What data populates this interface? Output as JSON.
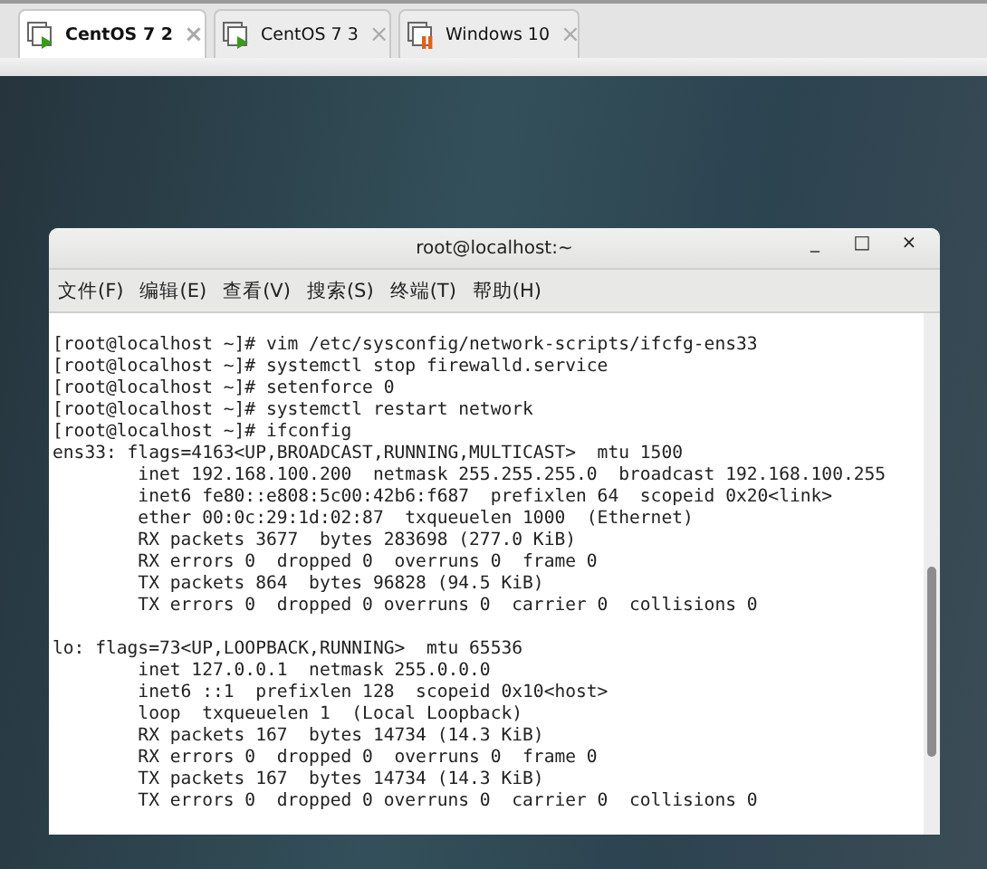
{
  "tabs": [
    {
      "label": "CentOS 7 2",
      "selected": true,
      "kind": "running",
      "close": "×"
    },
    {
      "label": "CentOS 7 3",
      "selected": false,
      "kind": "running",
      "close": "×"
    },
    {
      "label": "Windows 10",
      "selected": false,
      "kind": "paused",
      "close": "×"
    }
  ],
  "terminal": {
    "title": "root@localhost:~",
    "window_controls": [
      "_",
      "□",
      "×"
    ],
    "menu": [
      "文件(F)",
      "编辑(E)",
      "查看(V)",
      "搜索(S)",
      "终端(T)",
      "帮助(H)"
    ],
    "blocks": [
      [
        "[root@localhost ~]# vim /etc/sysconfig/network-scripts/ifcfg-ens33",
        "[root@localhost ~]# systemctl stop firewalld.service",
        "[root@localhost ~]# setenforce 0",
        "[root@localhost ~]# systemctl restart network",
        "[root@localhost ~]# ifconfig",
        "ens33: flags=4163<UP,BROADCAST,RUNNING,MULTICAST>  mtu 1500",
        "        inet 192.168.100.200  netmask 255.255.255.0  broadcast 192.168.100.255",
        "        inet6 fe80::e808:5c00:42b6:f687  prefixlen 64  scopeid 0x20<link>",
        "        ether 00:0c:29:1d:02:87  txqueuelen 1000  (Ethernet)",
        "        RX packets 3677  bytes 283698 (277.0 KiB)",
        "        RX errors 0  dropped 0  overruns 0  frame 0",
        "        TX packets 864  bytes 96828 (94.5 KiB)",
        "        TX errors 0  dropped 0 overruns 0  carrier 0  collisions 0"
      ],
      [
        "lo: flags=73<UP,LOOPBACK,RUNNING>  mtu 65536",
        "        inet 127.0.0.1  netmask 255.0.0.0",
        "        inet6 ::1  prefixlen 128  scopeid 0x10<host>",
        "        loop  txqueuelen 1  (Local Loopback)",
        "        RX packets 167  bytes 14734 (14.3 KiB)",
        "        RX errors 0  dropped 0  overruns 0  frame 0",
        "        TX packets 167  bytes 14734 (14.3 KiB)",
        "        TX errors 0  dropped 0 overruns 0  carrier 0  collisions 0"
      ]
    ]
  }
}
